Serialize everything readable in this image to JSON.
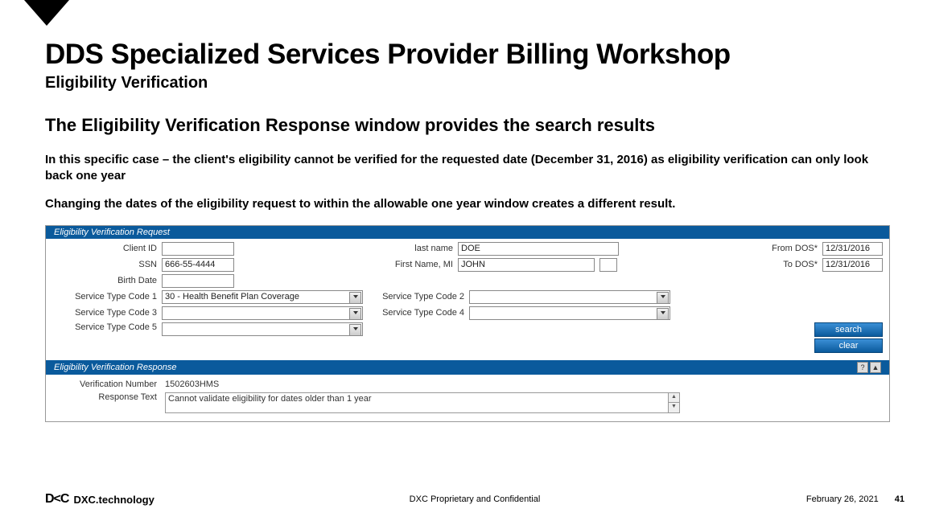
{
  "header": {
    "title": "DDS Specialized Services Provider Billing Workshop",
    "subtitle": "Eligibility Verification"
  },
  "main": {
    "section_title": "The Eligibility Verification Response window provides the search results",
    "para1": "In this specific case – the client's eligibility cannot be verified for the requested date (December 31, 2016) as eligibility verification can only look back one year",
    "para2": "Changing the dates of the eligibility request to within the allowable one year window creates a different result."
  },
  "request_panel": {
    "title": "Eligibility Verification Request",
    "labels": {
      "client_id": "Client ID",
      "ssn": "SSN",
      "birth_date": "Birth Date",
      "last_name": "last name",
      "first_name_mi": "First Name, MI",
      "from_dos": "From DOS*",
      "to_dos": "To DOS*",
      "stc1": "Service Type Code 1",
      "stc2": "Service Type Code 2",
      "stc3": "Service Type Code 3",
      "stc4": "Service Type Code 4",
      "stc5": "Service Type Code 5"
    },
    "values": {
      "client_id": "",
      "ssn": "666-55-4444",
      "birth_date": "",
      "last_name": "DOE",
      "first_name": "JOHN",
      "mi": "",
      "from_dos": "12/31/2016",
      "to_dos": "12/31/2016",
      "stc1": "30 - Health Benefit Plan Coverage",
      "stc2": "",
      "stc3": "",
      "stc4": "",
      "stc5": ""
    },
    "buttons": {
      "search": "search",
      "clear": "clear"
    }
  },
  "response_panel": {
    "title": "Eligibility Verification Response",
    "labels": {
      "verification_number": "Verification Number",
      "response_text": "Response Text"
    },
    "values": {
      "verification_number": "1502603HMS",
      "response_text": "Cannot validate eligibility for dates older than 1 year"
    },
    "icons": {
      "help": "?",
      "collapse": "▲"
    }
  },
  "footer": {
    "logo_text": "DXC.technology",
    "confidential": "DXC Proprietary and Confidential",
    "date": "February 26, 2021",
    "page": "41"
  }
}
